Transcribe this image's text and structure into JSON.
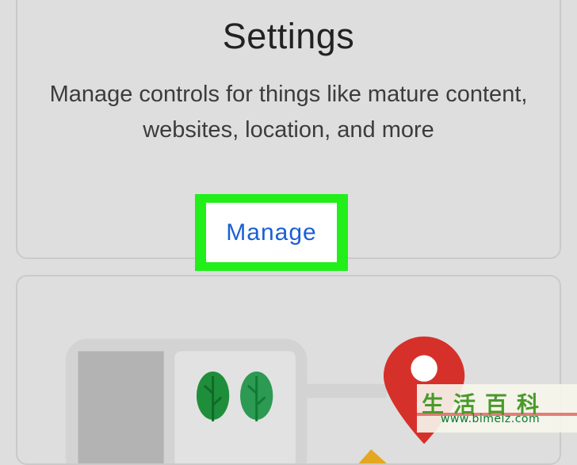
{
  "settings_card": {
    "title": "Settings",
    "description": "Manage controls for things like mature content, websites, location, and more",
    "manage_label": "Manage",
    "highlight_color": "#22ee1a",
    "link_color": "#1a5fd6"
  },
  "maps_card": {
    "icons": [
      "tree-icon",
      "tree-icon",
      "map-pin-icon",
      "building-icon"
    ]
  },
  "watermark": {
    "chars": "生活百科",
    "url": "www.bimeiz.com"
  }
}
